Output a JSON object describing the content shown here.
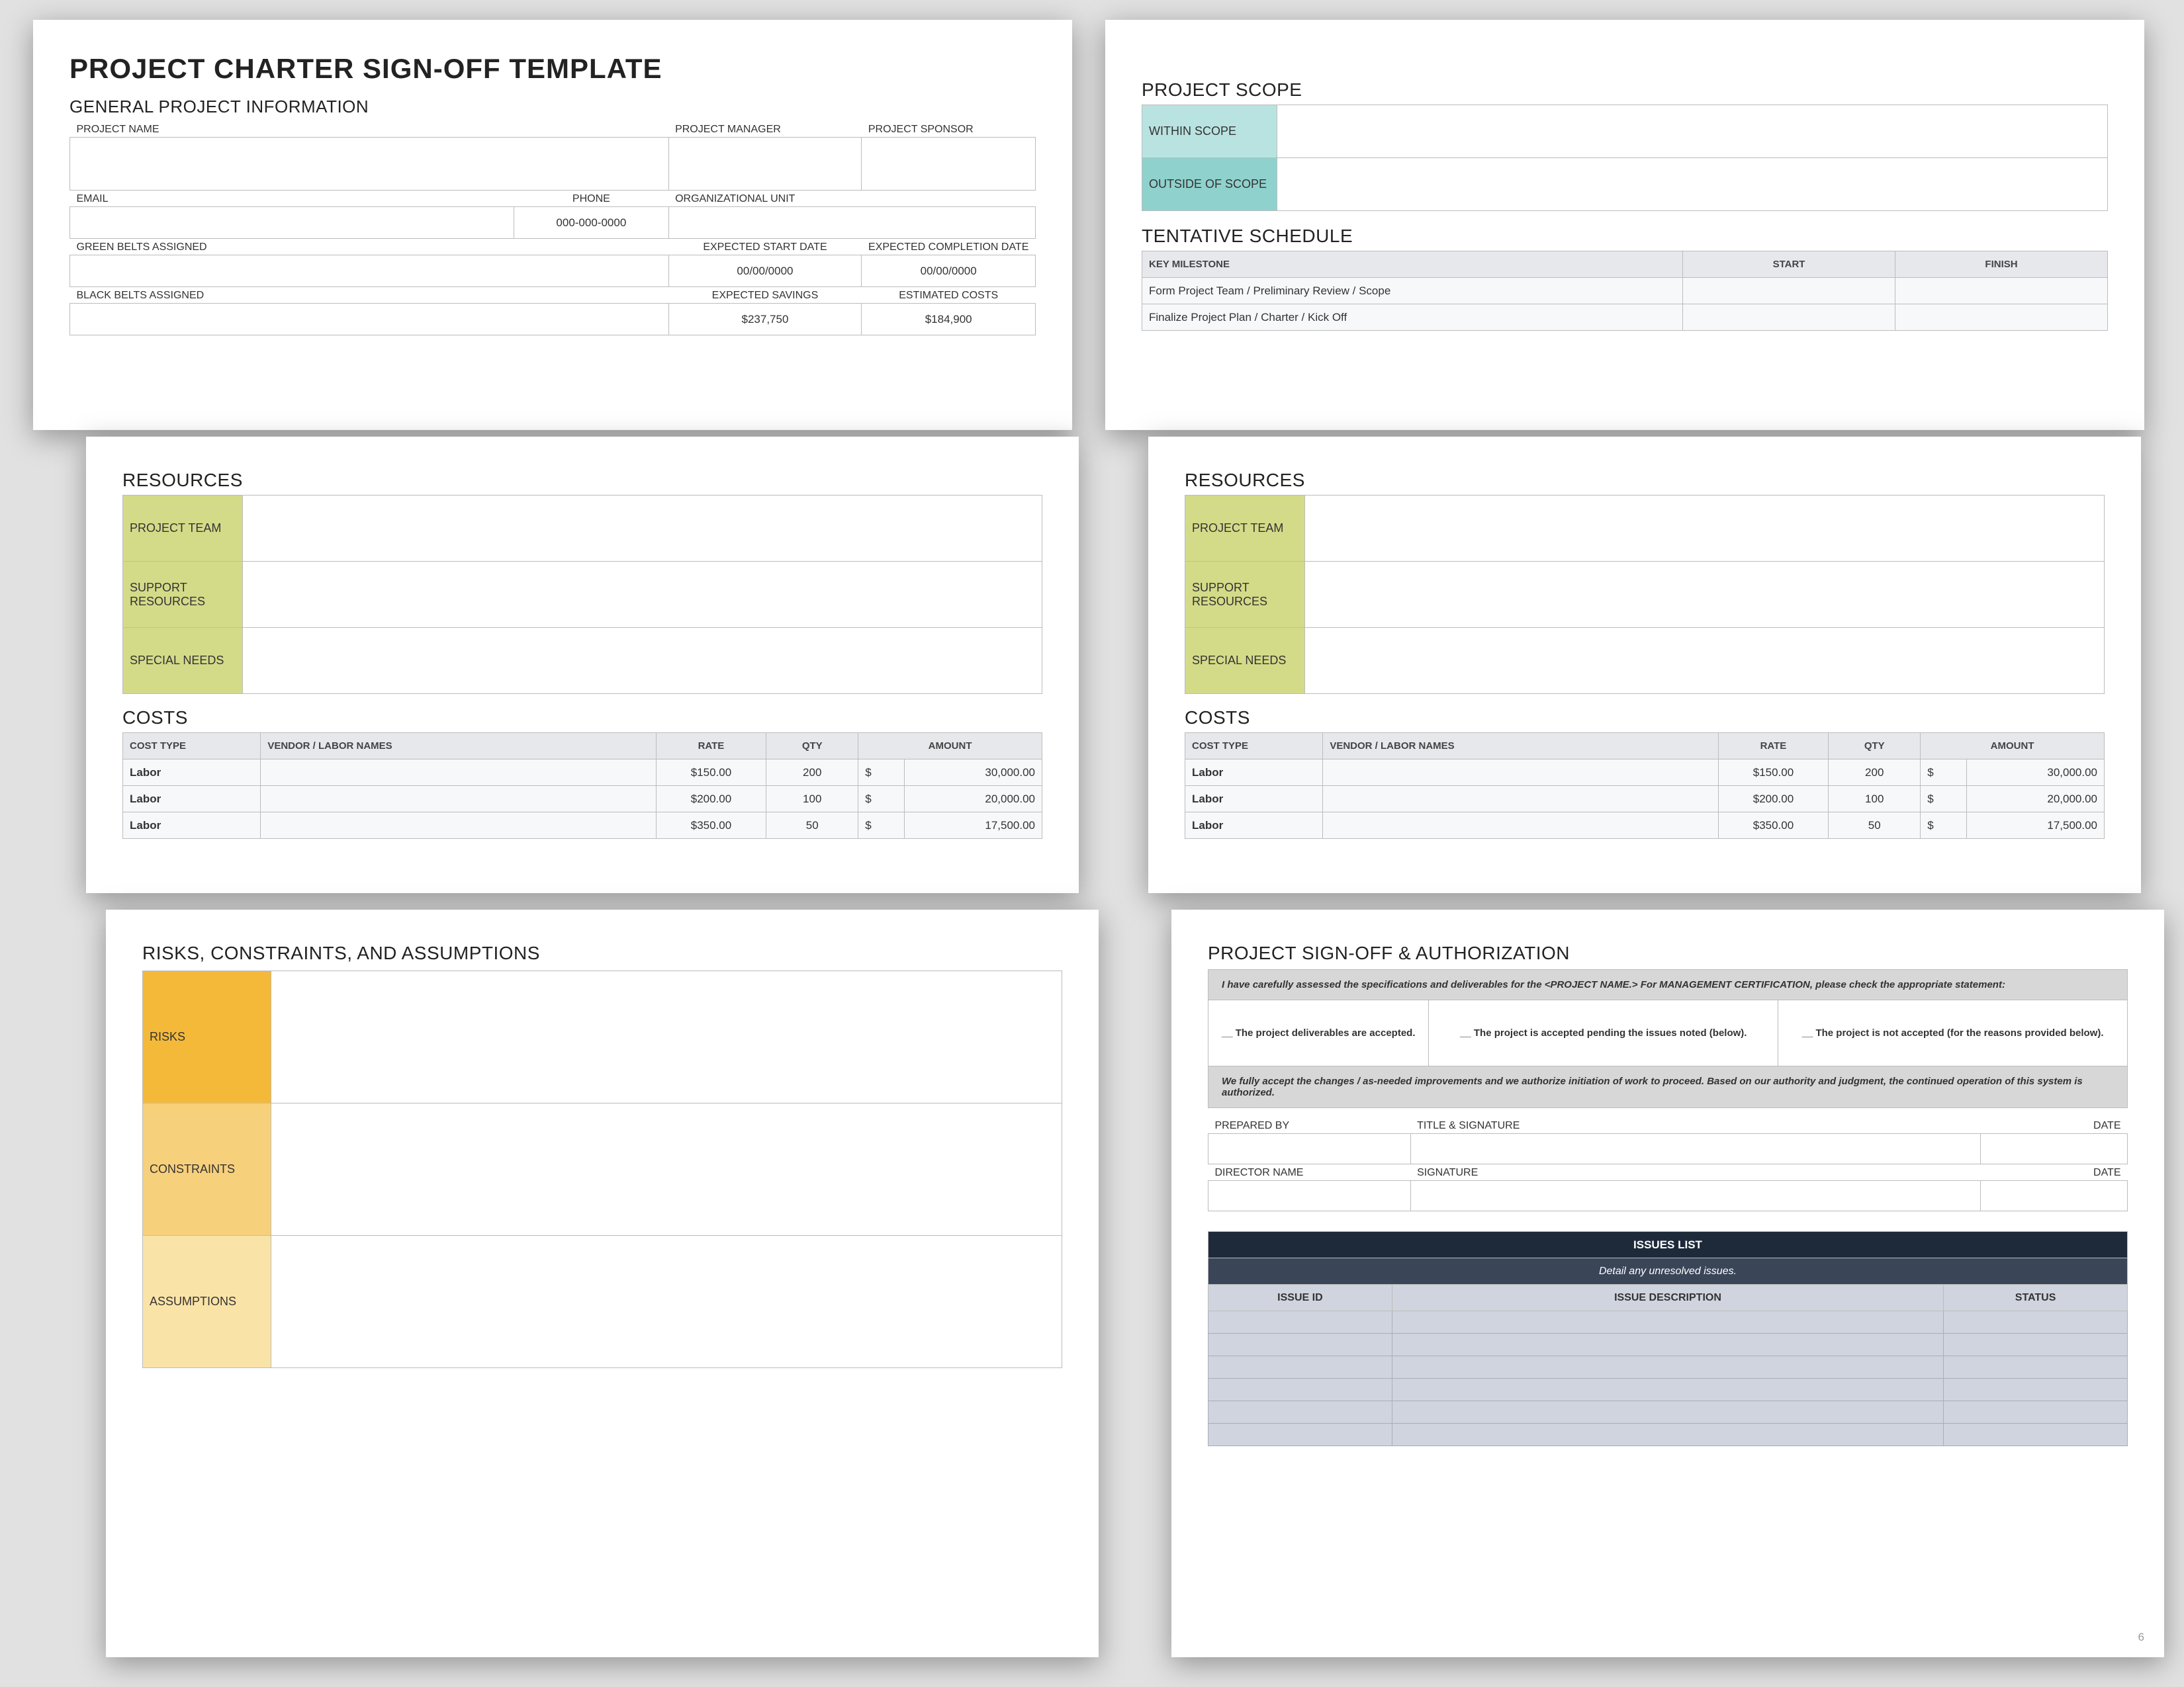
{
  "doc_title": "PROJECT CHARTER SIGN-OFF TEMPLATE",
  "general": {
    "heading": "GENERAL PROJECT INFORMATION",
    "project_name_lbl": "PROJECT NAME",
    "project_manager_lbl": "PROJECT MANAGER",
    "project_sponsor_lbl": "PROJECT SPONSOR",
    "email_lbl": "EMAIL",
    "phone_lbl": "PHONE",
    "org_unit_lbl": "ORGANIZATIONAL UNIT",
    "phone_placeholder": "000-000-0000",
    "green_belts_lbl": "GREEN BELTS ASSIGNED",
    "exp_start_lbl": "EXPECTED START DATE",
    "exp_complete_lbl": "EXPECTED COMPLETION DATE",
    "date_placeholder": "00/00/0000",
    "black_belts_lbl": "BLACK BELTS ASSIGNED",
    "exp_savings_lbl": "EXPECTED SAVINGS",
    "est_costs_lbl": "ESTIMATED COSTS",
    "exp_savings_val": "$237,750",
    "est_costs_val": "$184,900"
  },
  "scope": {
    "heading": "PROJECT SCOPE",
    "within_lbl": "WITHIN SCOPE",
    "outside_lbl": "OUTSIDE OF SCOPE"
  },
  "schedule": {
    "heading": "TENTATIVE SCHEDULE",
    "col_milestone": "KEY MILESTONE",
    "col_start": "START",
    "col_finish": "FINISH",
    "rows": [
      "Form Project Team / Preliminary Review / Scope",
      "Finalize Project Plan / Charter / Kick Off"
    ]
  },
  "resources": {
    "heading": "RESOURCES",
    "project_team_lbl": "PROJECT TEAM",
    "support_lbl": "SUPPORT RESOURCES",
    "special_lbl": "SPECIAL NEEDS"
  },
  "costs": {
    "heading": "COSTS",
    "col_type": "COST TYPE",
    "col_vendor": "VENDOR / LABOR NAMES",
    "col_rate": "RATE",
    "col_qty": "QTY",
    "col_amount": "AMOUNT",
    "rows": [
      {
        "type": "Labor",
        "rate": "$150.00",
        "qty": "200",
        "cur": "$",
        "amount": "30,000.00"
      },
      {
        "type": "Labor",
        "rate": "$200.00",
        "qty": "100",
        "cur": "$",
        "amount": "20,000.00"
      },
      {
        "type": "Labor",
        "rate": "$350.00",
        "qty": "50",
        "cur": "$",
        "amount": "17,500.00"
      }
    ]
  },
  "risks": {
    "heading": "RISKS, CONSTRAINTS, AND ASSUMPTIONS",
    "risks_lbl": "RISKS",
    "constraints_lbl": "CONSTRAINTS",
    "assumptions_lbl": "ASSUMPTIONS"
  },
  "signoff": {
    "heading": "PROJECT SIGN-OFF & AUTHORIZATION",
    "assessment_text": "I have carefully assessed the specifications and deliverables for the <PROJECT NAME.> For MANAGEMENT CERTIFICATION, please check the appropriate statement:",
    "opt1": "__ The project deliverables are accepted.",
    "opt2": "__ The project is accepted pending the issues noted (below).",
    "opt3": "__ The project is not accepted (for the reasons provided below).",
    "accept_text": "We fully accept the changes / as-needed improvements and we authorize initiation of work to proceed. Based on our authority and judgment, the continued operation of this system is authorized.",
    "prepared_by_lbl": "PREPARED BY",
    "title_sig_lbl": "TITLE & SIGNATURE",
    "date_lbl": "DATE",
    "director_lbl": "DIRECTOR NAME",
    "signature_lbl": "SIGNATURE",
    "issues_title": "ISSUES LIST",
    "issues_sub": "Detail any unresolved issues.",
    "issues_id": "ISSUE ID",
    "issues_desc": "ISSUE DESCRIPTION",
    "issues_status": "STATUS"
  },
  "page_number": "6"
}
